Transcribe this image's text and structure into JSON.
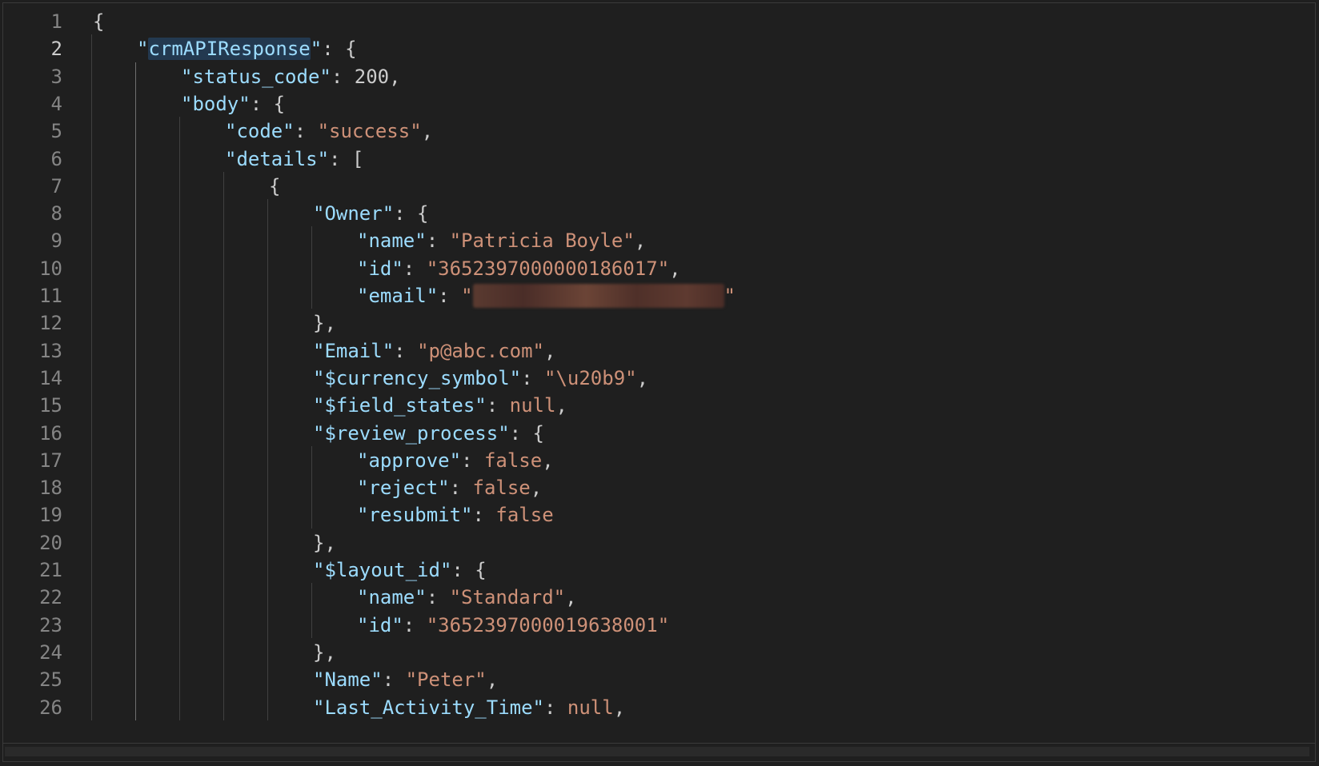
{
  "editor": {
    "active_line": 2,
    "lines": [
      {
        "num": "1",
        "indent": 0,
        "tokens": [
          {
            "t": "p",
            "v": "{"
          }
        ]
      },
      {
        "num": "2",
        "indent": 1,
        "tokens": [
          {
            "t": "k",
            "v": "\""
          },
          {
            "t": "k",
            "v": "crmAPIResponse",
            "hl": true
          },
          {
            "t": "k",
            "v": "\""
          },
          {
            "t": "p",
            "v": ": {"
          }
        ]
      },
      {
        "num": "3",
        "indent": 2,
        "tokens": [
          {
            "t": "k",
            "v": "\"status_code\""
          },
          {
            "t": "p",
            "v": ": "
          },
          {
            "t": "n",
            "v": "200"
          },
          {
            "t": "p",
            "v": ","
          }
        ]
      },
      {
        "num": "4",
        "indent": 2,
        "tokens": [
          {
            "t": "k",
            "v": "\"body\""
          },
          {
            "t": "p",
            "v": ": {"
          }
        ]
      },
      {
        "num": "5",
        "indent": 3,
        "tokens": [
          {
            "t": "k",
            "v": "\"code\""
          },
          {
            "t": "p",
            "v": ": "
          },
          {
            "t": "s",
            "v": "\"success\""
          },
          {
            "t": "p",
            "v": ","
          }
        ]
      },
      {
        "num": "6",
        "indent": 3,
        "tokens": [
          {
            "t": "k",
            "v": "\"details\""
          },
          {
            "t": "p",
            "v": ": ["
          }
        ]
      },
      {
        "num": "7",
        "indent": 4,
        "tokens": [
          {
            "t": "p",
            "v": "{"
          }
        ]
      },
      {
        "num": "8",
        "indent": 5,
        "tokens": [
          {
            "t": "k",
            "v": "\"Owner\""
          },
          {
            "t": "p",
            "v": ": {"
          }
        ]
      },
      {
        "num": "9",
        "indent": 6,
        "tokens": [
          {
            "t": "k",
            "v": "\"name\""
          },
          {
            "t": "p",
            "v": ": "
          },
          {
            "t": "s",
            "v": "\"Patricia Boyle\""
          },
          {
            "t": "p",
            "v": ","
          }
        ]
      },
      {
        "num": "10",
        "indent": 6,
        "tokens": [
          {
            "t": "k",
            "v": "\"id\""
          },
          {
            "t": "p",
            "v": ": "
          },
          {
            "t": "s",
            "v": "\"3652397000000186017\""
          },
          {
            "t": "p",
            "v": ","
          }
        ]
      },
      {
        "num": "11",
        "indent": 6,
        "tokens": [
          {
            "t": "k",
            "v": "\"email\""
          },
          {
            "t": "p",
            "v": ": "
          },
          {
            "t": "s",
            "v": "\""
          },
          {
            "t": "redacted",
            "v": ""
          },
          {
            "t": "s",
            "v": "\""
          }
        ]
      },
      {
        "num": "12",
        "indent": 5,
        "tokens": [
          {
            "t": "p",
            "v": "},"
          }
        ]
      },
      {
        "num": "13",
        "indent": 5,
        "tokens": [
          {
            "t": "k",
            "v": "\"Email\""
          },
          {
            "t": "p",
            "v": ": "
          },
          {
            "t": "s",
            "v": "\"p@abc.com\""
          },
          {
            "t": "p",
            "v": ","
          }
        ]
      },
      {
        "num": "14",
        "indent": 5,
        "tokens": [
          {
            "t": "k",
            "v": "\"$currency_symbol\""
          },
          {
            "t": "p",
            "v": ": "
          },
          {
            "t": "s",
            "v": "\"\\u20b9\""
          },
          {
            "t": "p",
            "v": ","
          }
        ]
      },
      {
        "num": "15",
        "indent": 5,
        "tokens": [
          {
            "t": "k",
            "v": "\"$field_states\""
          },
          {
            "t": "p",
            "v": ": "
          },
          {
            "t": "kw",
            "v": "null"
          },
          {
            "t": "p",
            "v": ","
          }
        ]
      },
      {
        "num": "16",
        "indent": 5,
        "tokens": [
          {
            "t": "k",
            "v": "\"$review_process\""
          },
          {
            "t": "p",
            "v": ": {"
          }
        ]
      },
      {
        "num": "17",
        "indent": 6,
        "tokens": [
          {
            "t": "k",
            "v": "\"approve\""
          },
          {
            "t": "p",
            "v": ": "
          },
          {
            "t": "kw",
            "v": "false"
          },
          {
            "t": "p",
            "v": ","
          }
        ]
      },
      {
        "num": "18",
        "indent": 6,
        "tokens": [
          {
            "t": "k",
            "v": "\"reject\""
          },
          {
            "t": "p",
            "v": ": "
          },
          {
            "t": "kw",
            "v": "false"
          },
          {
            "t": "p",
            "v": ","
          }
        ]
      },
      {
        "num": "19",
        "indent": 6,
        "tokens": [
          {
            "t": "k",
            "v": "\"resubmit\""
          },
          {
            "t": "p",
            "v": ": "
          },
          {
            "t": "kw",
            "v": "false"
          }
        ]
      },
      {
        "num": "20",
        "indent": 5,
        "tokens": [
          {
            "t": "p",
            "v": "},"
          }
        ]
      },
      {
        "num": "21",
        "indent": 5,
        "tokens": [
          {
            "t": "k",
            "v": "\"$layout_id\""
          },
          {
            "t": "p",
            "v": ": {"
          }
        ]
      },
      {
        "num": "22",
        "indent": 6,
        "tokens": [
          {
            "t": "k",
            "v": "\"name\""
          },
          {
            "t": "p",
            "v": ": "
          },
          {
            "t": "s",
            "v": "\"Standard\""
          },
          {
            "t": "p",
            "v": ","
          }
        ]
      },
      {
        "num": "23",
        "indent": 6,
        "tokens": [
          {
            "t": "k",
            "v": "\"id\""
          },
          {
            "t": "p",
            "v": ": "
          },
          {
            "t": "s",
            "v": "\"3652397000019638001\""
          }
        ]
      },
      {
        "num": "24",
        "indent": 5,
        "tokens": [
          {
            "t": "p",
            "v": "},"
          }
        ]
      },
      {
        "num": "25",
        "indent": 5,
        "tokens": [
          {
            "t": "k",
            "v": "\"Name\""
          },
          {
            "t": "p",
            "v": ": "
          },
          {
            "t": "s",
            "v": "\"Peter\""
          },
          {
            "t": "p",
            "v": ","
          }
        ]
      },
      {
        "num": "26",
        "indent": 5,
        "tokens": [
          {
            "t": "k",
            "v": "\"Last_Activity_Time\""
          },
          {
            "t": "p",
            "v": ": "
          },
          {
            "t": "kw",
            "v": "null"
          },
          {
            "t": "p",
            "v": ","
          }
        ]
      }
    ]
  }
}
